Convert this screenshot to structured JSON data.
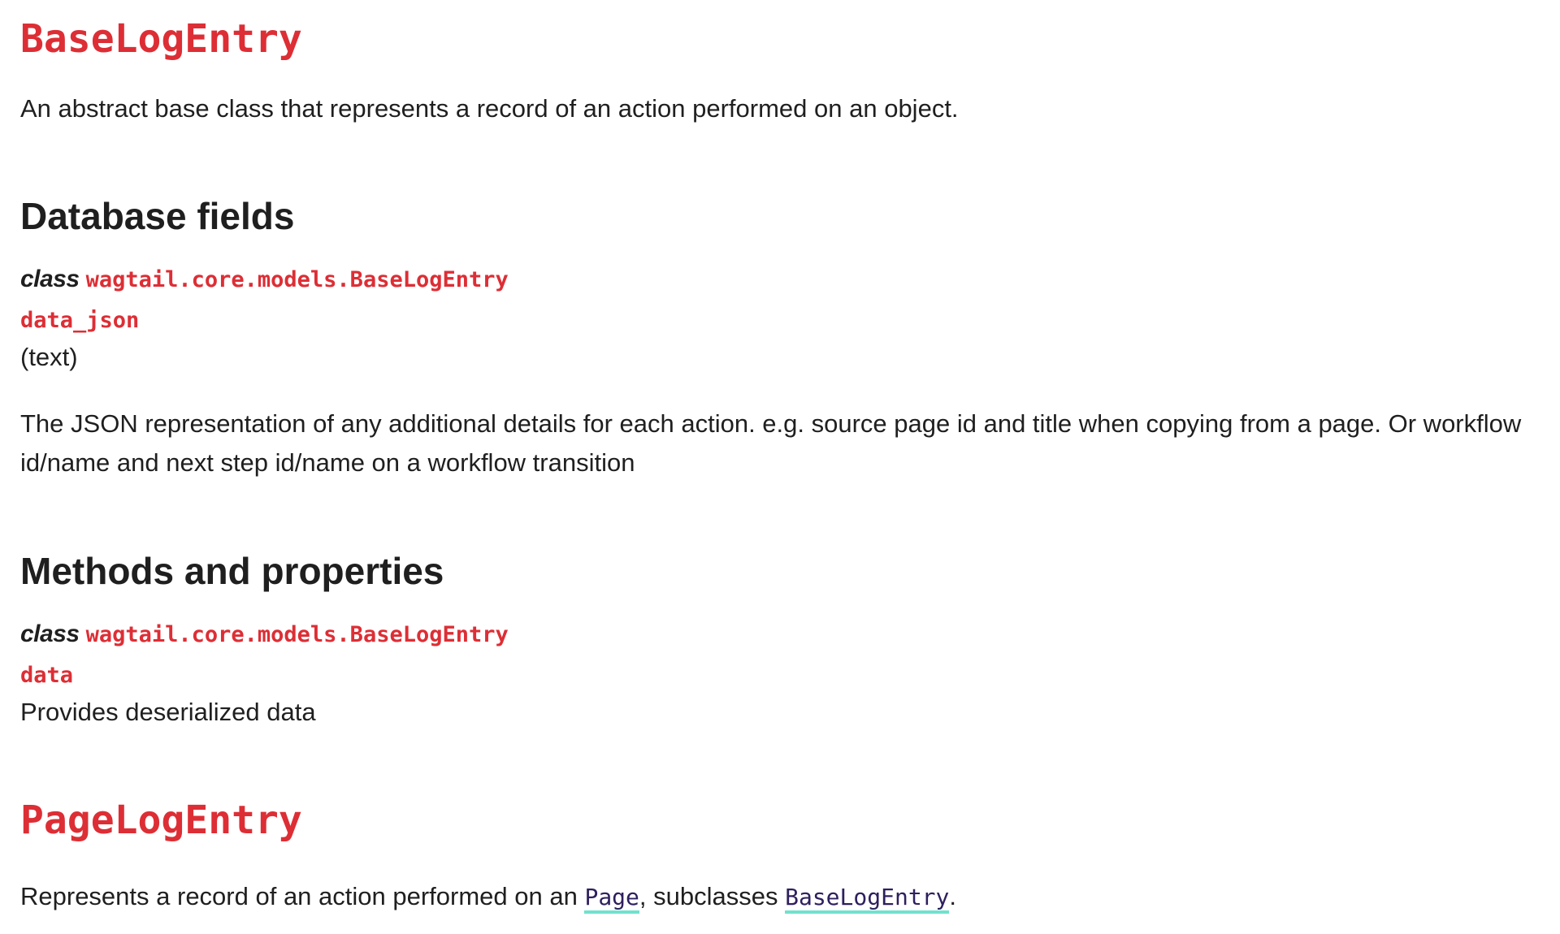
{
  "base_section": {
    "title": "BaseLogEntry",
    "intro": "An abstract base class that represents a record of an action performed on an object."
  },
  "database_fields": {
    "heading": "Database fields",
    "class_keyword": "class",
    "class_path": "wagtail.core.models.BaseLogEntry",
    "field_name": "data_json",
    "field_type": "(text)",
    "description_line1": "The JSON representation of any additional details for each action. e.g. source page id and title when copying from a page. Or workflow",
    "description_line2": "id/name and next step id/name on a workflow transition"
  },
  "methods": {
    "heading": "Methods and properties",
    "class_keyword": "class",
    "class_path": "wagtail.core.models.BaseLogEntry",
    "attr_name": "data",
    "attr_description": "Provides deserialized data"
  },
  "page_section": {
    "title": "PageLogEntry",
    "text_before": "Represents a record of an action performed on an ",
    "link_page": "Page",
    "text_middle": ", subclasses ",
    "link_base": "BaseLogEntry",
    "text_after": "."
  }
}
